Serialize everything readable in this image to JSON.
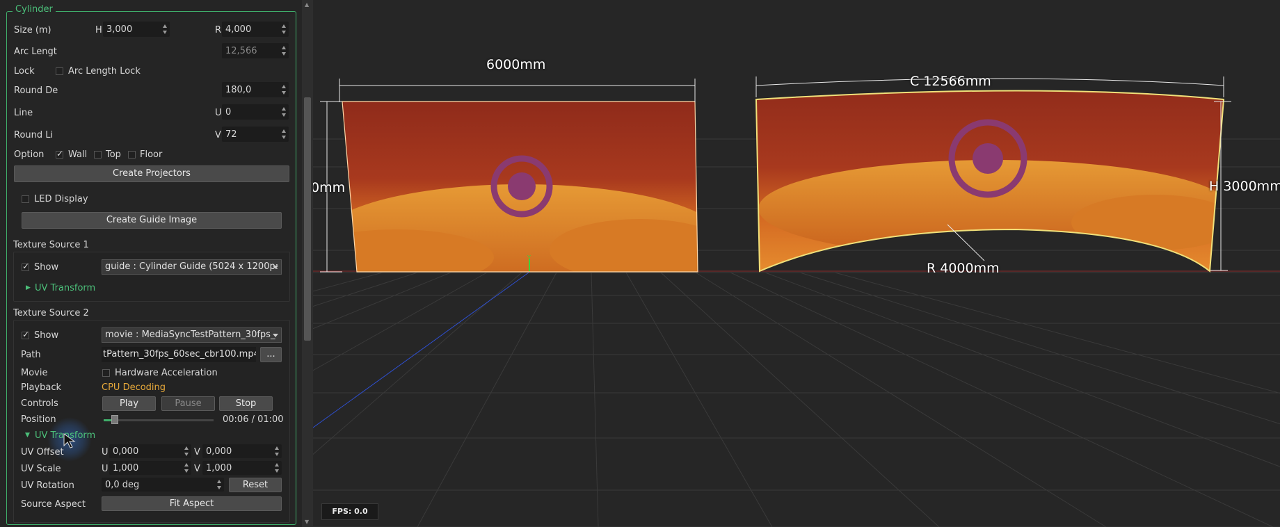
{
  "panel": {
    "group_title": "Cylinder",
    "size": {
      "label": "Size (m)",
      "h_label": "H",
      "h_value": "3,000",
      "r_label": "R",
      "r_value": "4,000"
    },
    "arc_length": {
      "label": "Arc Lengt",
      "value": "12,566"
    },
    "lock": {
      "label": "Lock",
      "checkbox_label": "Arc Length Lock",
      "checked": false
    },
    "round_degree": {
      "label": "Round De",
      "value": "180,0"
    },
    "line": {
      "label": "Line",
      "u_label": "U",
      "u_value": "0"
    },
    "round_line": {
      "label": "Round Li",
      "v_label": "V",
      "v_value": "72"
    },
    "option": {
      "label": "Option",
      "wall": "Wall",
      "wall_checked": true,
      "top": "Top",
      "top_checked": false,
      "floor": "Floor",
      "floor_checked": false
    },
    "create_projectors": "Create Projectors",
    "led_display": {
      "label": "LED Display",
      "checked": false
    },
    "create_guide_image": "Create Guide Image",
    "texture1": {
      "title": "Texture Source 1",
      "show_label": "Show",
      "show_checked": true,
      "source": "guide : Cylinder Guide (5024 x 1200p:",
      "uv_transform": "UV Transform"
    },
    "texture2": {
      "title": "Texture Source 2",
      "show_label": "Show",
      "show_checked": true,
      "source": "movie : MediaSyncTestPattern_30fps_",
      "path_label": "Path",
      "path_value": "tPattern_30fps_60sec_cbr100.mp4",
      "browse": "...",
      "movie_label": "Movie",
      "hw_accel": "Hardware Acceleration",
      "hw_checked": false,
      "playback_label": "Playback",
      "playback_value": "CPU Decoding",
      "controls_label": "Controls",
      "play": "Play",
      "pause": "Pause",
      "stop": "Stop",
      "position_label": "Position",
      "position_fraction": 0.1,
      "position_time": "00:06 / 01:00",
      "uv_transform": "UV Transform",
      "uv_offset_label": "UV Offset",
      "uv_offset_u_label": "U",
      "uv_offset_u": "0,000",
      "uv_offset_v_label": "V",
      "uv_offset_v": "0,000",
      "uv_scale_label": "UV Scale",
      "uv_scale_u_label": "U",
      "uv_scale_u": "1,000",
      "uv_scale_v_label": "V",
      "uv_scale_v": "1,000",
      "uv_rotation_label": "UV Rotation",
      "uv_rotation_value": "0,0 deg",
      "reset": "Reset",
      "source_aspect_label": "Source Aspect",
      "fit_aspect": "Fit Aspect"
    }
  },
  "viewport": {
    "width_label": "6000mm",
    "height_left_label": "0mm",
    "circumference_label": "C 12566mm",
    "height_right_label": "H 3000mm",
    "radius_label": "R 4000mm",
    "fps": "FPS: 0.0",
    "axis_label": "Y"
  },
  "colors": {
    "accent": "#3fae6a",
    "playback": "#e7a93a",
    "bg": "#252525"
  }
}
